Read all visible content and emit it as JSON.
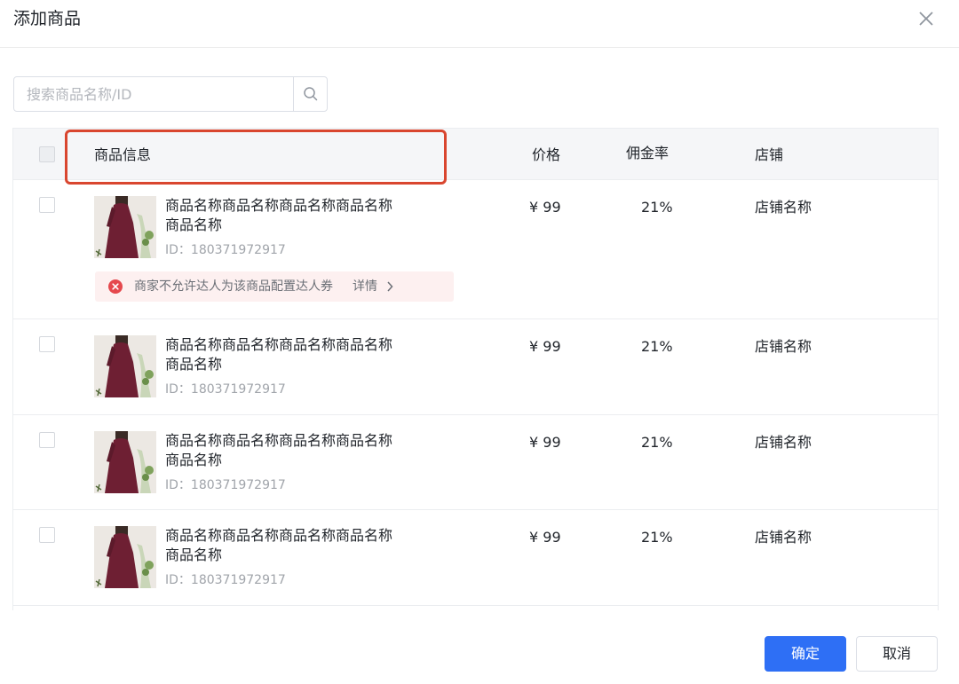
{
  "dialog": {
    "title": "添加商品",
    "close_icon": "close-icon"
  },
  "search": {
    "placeholder": "搜索商品名称/ID",
    "value": "",
    "icon": "search-icon"
  },
  "table": {
    "columns": {
      "info": "商品信息",
      "price": "价格",
      "rate": "佣金率",
      "shop": "店铺"
    },
    "rows": [
      {
        "name_line1": "商品名称商品名称商品名称商品名称",
        "name_line2": "商品名称",
        "id": "ID：180371972917",
        "price": "¥ 99",
        "rate": "21%",
        "shop": "店铺名称",
        "warning": {
          "text": "商家不允许达人为该商品配置达人券",
          "link": "详情",
          "icon": "error-circle-icon",
          "color": "#e5484d"
        }
      },
      {
        "name_line1": "商品名称商品名称商品名称商品名称",
        "name_line2": "商品名称",
        "id": "ID：180371972917",
        "price": "¥ 99",
        "rate": "21%",
        "shop": "店铺名称"
      },
      {
        "name_line1": "商品名称商品名称商品名称商品名称",
        "name_line2": "商品名称",
        "id": "ID：180371972917",
        "price": "¥ 99",
        "rate": "21%",
        "shop": "店铺名称"
      },
      {
        "name_line1": "商品名称商品名称商品名称商品名称",
        "name_line2": "商品名称",
        "id": "ID：180371972917",
        "price": "¥ 99",
        "rate": "21%",
        "shop": "店铺名称"
      }
    ]
  },
  "footer": {
    "confirm_label": "确定",
    "cancel_label": "取消"
  },
  "colors": {
    "primary": "#2e6ff5",
    "error": "#e5484d",
    "highlight_frame": "#d9462f",
    "product_dress": "#6e1f33"
  }
}
